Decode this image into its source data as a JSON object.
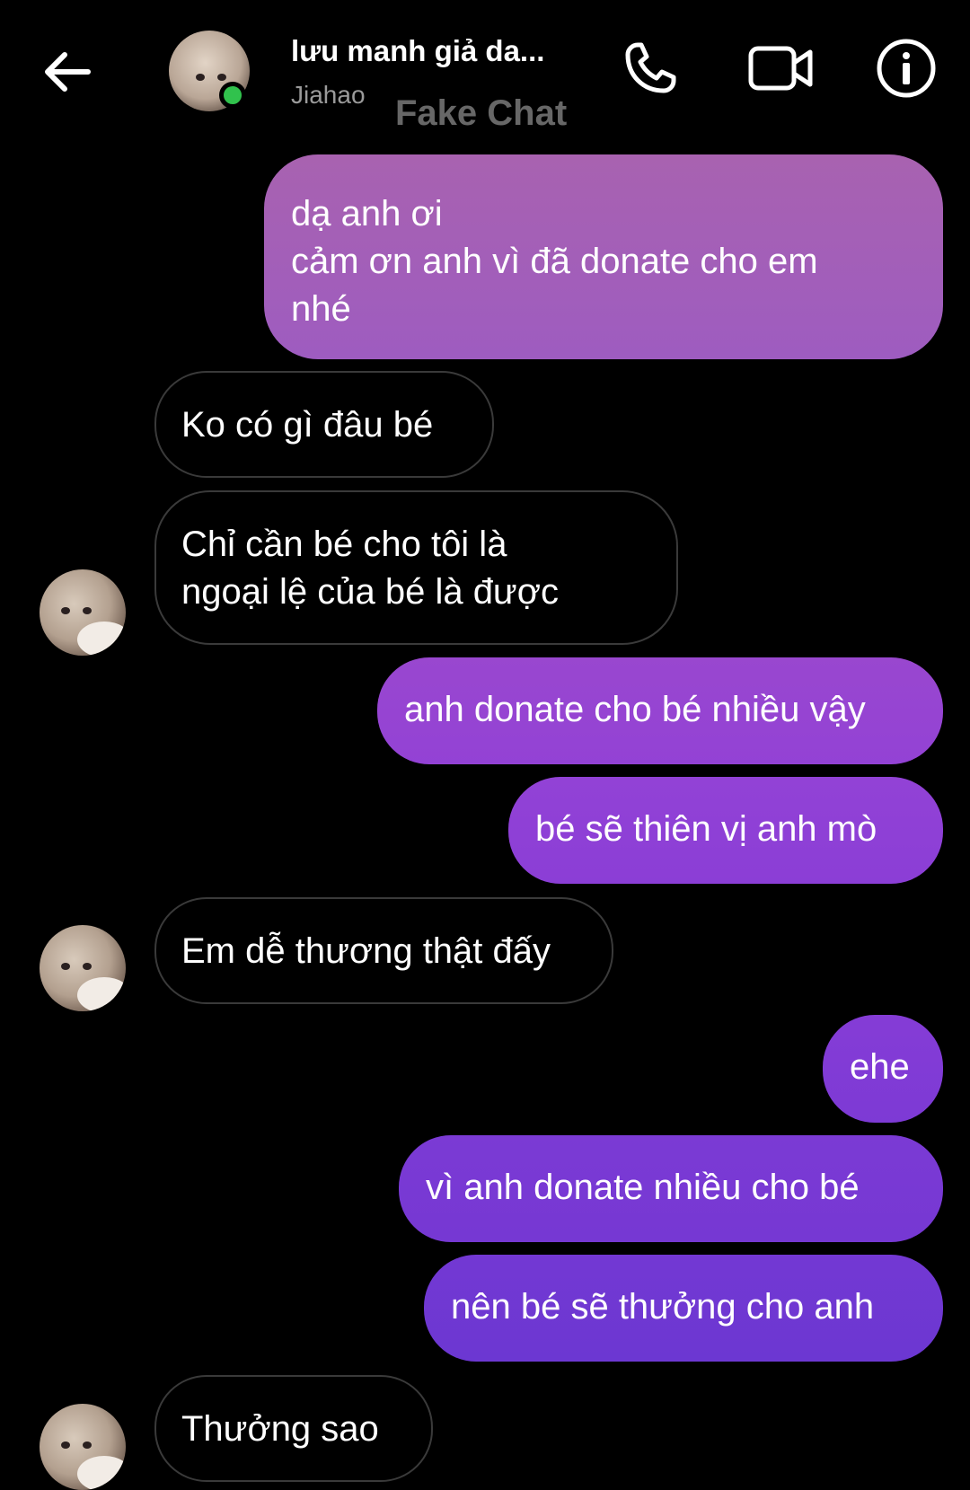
{
  "header": {
    "title": "lưu manh giả da...",
    "subtitle": "Jiahao",
    "watermark": "Fake Chat",
    "icons": [
      "back-arrow-icon",
      "phone-icon",
      "video-camera-icon",
      "info-icon"
    ]
  },
  "colors": {
    "background": "#000000",
    "online": "#31c24d",
    "outgoing_top": "#a862b0",
    "outgoing_mid": "#9140d6",
    "outgoing_bottom": "#6f38d3",
    "incoming_border": "#3a3a3a"
  },
  "messages": [
    {
      "dir": "out",
      "text": "dạ anh ơi\ncảm ơn anh vì đã donate cho em\nnhé"
    },
    {
      "dir": "in",
      "text": "Ko có gì đâu bé"
    },
    {
      "dir": "in",
      "text": "Chỉ cần bé cho tôi là\nngoại lệ của bé là được"
    },
    {
      "dir": "out",
      "text": "anh donate cho bé nhiều vậy"
    },
    {
      "dir": "out",
      "text": "bé sẽ thiên vị anh mò"
    },
    {
      "dir": "in",
      "text": "Em dễ thương thật đấy"
    },
    {
      "dir": "out",
      "text": "ehe"
    },
    {
      "dir": "out",
      "text": "vì anh donate nhiều cho bé"
    },
    {
      "dir": "out",
      "text": "nên bé sẽ thưởng cho anh"
    },
    {
      "dir": "in",
      "text": "Thưởng sao"
    }
  ]
}
